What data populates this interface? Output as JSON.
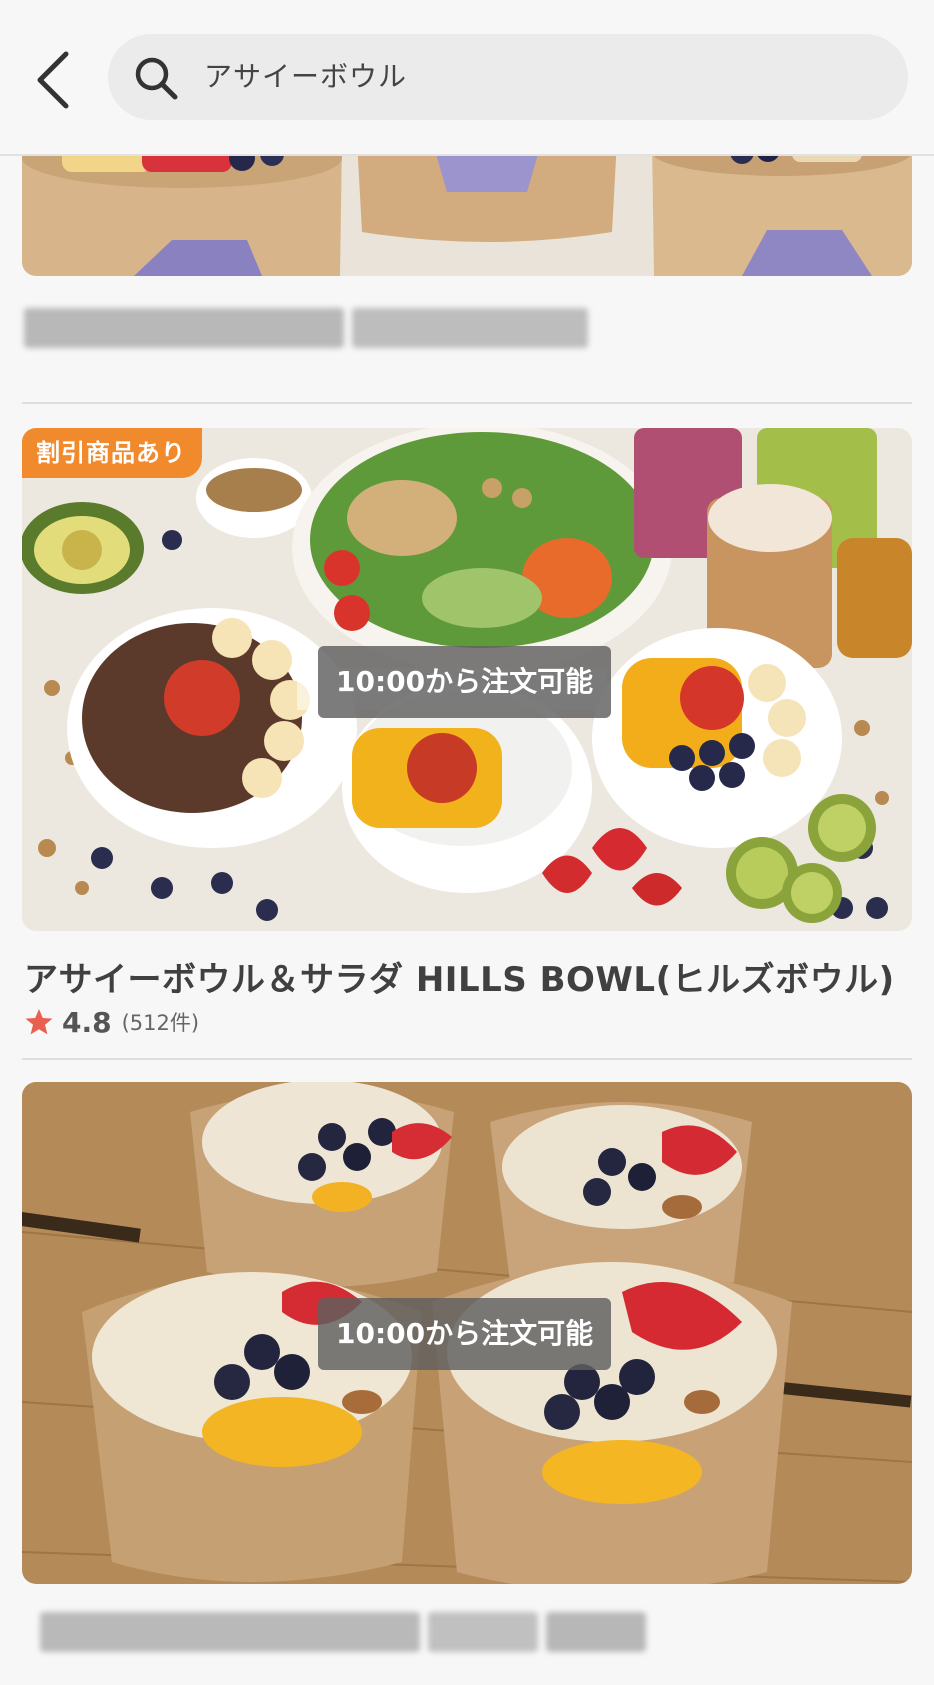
{
  "search": {
    "query": "アサイーボウル"
  },
  "colors": {
    "badge_orange": "#f08a2c",
    "rating_star": "#e8604f",
    "overlay_gray": "#5f5f5f"
  },
  "icons": {
    "back": "chevron-left-icon",
    "search": "search-icon",
    "rating": "star-icon"
  },
  "results": [
    {
      "name_blurred": true,
      "image_desc": "acai bowls in kraft paper cups"
    },
    {
      "badge": "割引商品あり",
      "availability": "10:00から注文可能",
      "name": "アサイーボウル＆サラダ HILLS BOWL(ヒルズボウル)",
      "rating": "4.8",
      "review_count": "(512件)"
    },
    {
      "availability": "10:00から注文可能",
      "name_blurred": true
    }
  ]
}
